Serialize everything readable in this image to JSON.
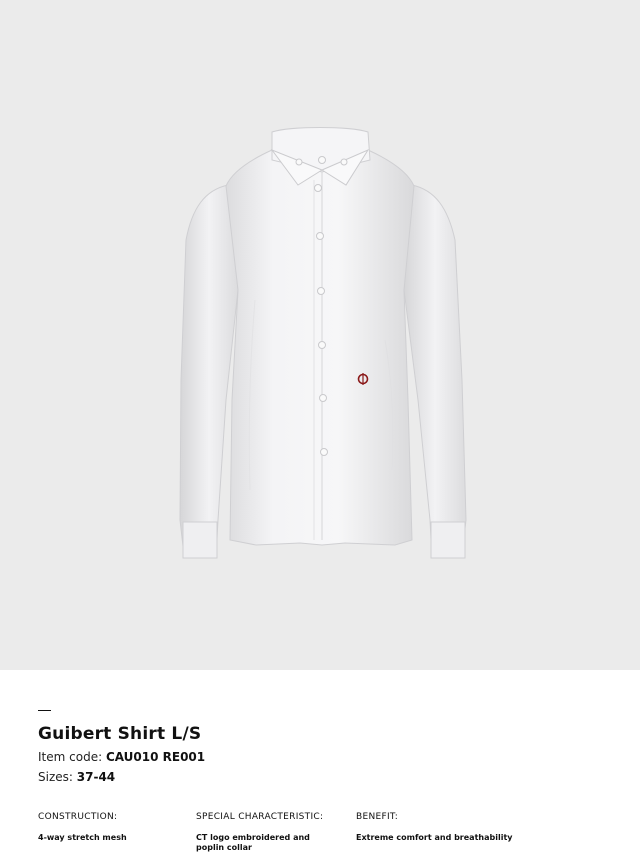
{
  "product": {
    "title": "Guibert Shirt L/S",
    "item_code_label": "Item code:",
    "item_code": "CAU010 RE001",
    "sizes_label": "Sizes:",
    "sizes": "37-44"
  },
  "specs": [
    {
      "heading": "CONSTRUCTION:",
      "value": "4-way stretch mesh"
    },
    {
      "heading": "SPECIAL CHARACTERISTIC:",
      "value": "CT logo embroidered and poplin collar"
    },
    {
      "heading": "BENEFIT:",
      "value": "Extreme comfort and breathability"
    }
  ],
  "image": {
    "subject": "white long-sleeve shirt",
    "background_color": "#ebebeb",
    "logo_color": "#8b1a1a"
  },
  "colors": {
    "page_bg": "#ffffff",
    "text": "#111111"
  }
}
